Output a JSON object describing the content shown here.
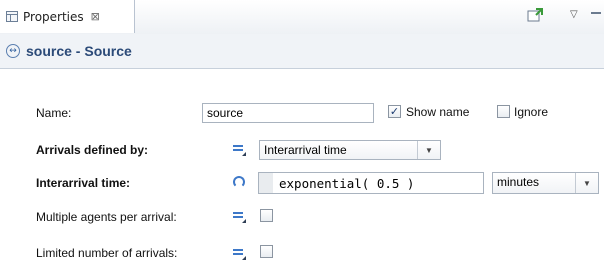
{
  "tab": {
    "label": "Properties",
    "close_glyph": "⊠"
  },
  "toolbar": {
    "pin_icon": "pin-icon",
    "menu_icon": "view-menu-icon",
    "minimize_icon": "minimize-icon"
  },
  "header": {
    "title": "source - Source",
    "icon": "agent-icon"
  },
  "fields": {
    "name": {
      "label": "Name:",
      "value": "source"
    },
    "show_name": {
      "label": "Show name",
      "checked": true
    },
    "ignore": {
      "label": "Ignore",
      "checked": false
    },
    "arrivals_defined_by": {
      "label": "Arrivals defined by:",
      "value": "Interarrival time"
    },
    "interarrival_time": {
      "label": "Interarrival time:",
      "value": "exponential( 0.5 )",
      "unit": "minutes"
    },
    "multiple_agents": {
      "label": "Multiple agents per arrival:",
      "checked": false
    },
    "limited_arrivals": {
      "label": "Limited number of arrivals:",
      "checked": false
    }
  },
  "colors": {
    "header_title": "#2b4a78",
    "icon_blue": "#3d78c8"
  }
}
